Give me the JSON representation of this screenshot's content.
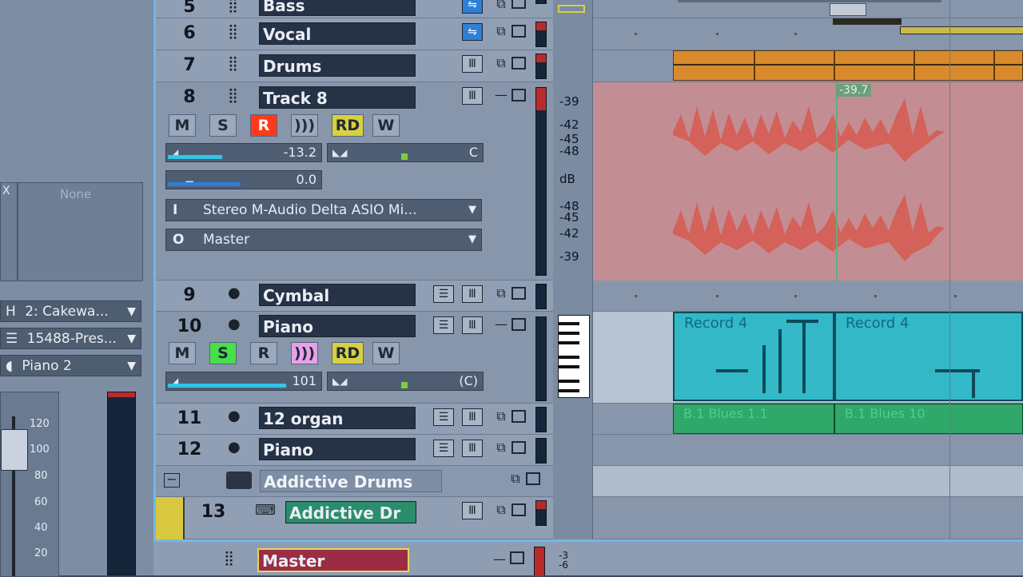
{
  "inspector": {
    "plugin_slot": "None",
    "x_label": "X",
    "dropdowns": [
      {
        "prefix": "H",
        "value": "2: Cakewa..."
      },
      {
        "prefix": "☰",
        "value": "15488-Pres..."
      },
      {
        "prefix": "◖",
        "value": "Piano 2"
      }
    ],
    "fader_scale": [
      "120",
      "100",
      "80",
      "60",
      "40",
      "20"
    ]
  },
  "tracks": [
    {
      "num": "5",
      "name": "Bass"
    },
    {
      "num": "6",
      "name": "Vocal"
    },
    {
      "num": "7",
      "name": "Drums"
    },
    {
      "num": "8",
      "name": "Track 8",
      "buttons": [
        "M",
        "S",
        "R",
        "))) ",
        "RD",
        "W"
      ],
      "volume": "-13.2",
      "volume_level": 0.36,
      "pan": "C",
      "pan_level": 0.5,
      "trim": "0.0",
      "trim_level": 0.48,
      "input_prefix": "I",
      "input": "Stereo M-Audio Delta ASIO Mi...",
      "output_prefix": "O",
      "output": "Master"
    },
    {
      "num": "9",
      "name": "Cymbal"
    },
    {
      "num": "10",
      "name": "Piano",
      "buttons": [
        "M",
        "S",
        "R",
        ")))",
        "RD",
        "W"
      ],
      "volume": "101",
      "volume_level": 0.78,
      "pan": "(C)",
      "pan_level": 0.5
    },
    {
      "num": "11",
      "name": "12 organ"
    },
    {
      "num": "12",
      "name": "Piano"
    },
    {
      "num": "",
      "name": "Addictive Drums"
    },
    {
      "num": "13",
      "name": "Addictive Dr"
    },
    {
      "num": "",
      "name": "Master"
    }
  ],
  "ruler": {
    "db_labels_top": [
      "-39",
      "-42",
      "-45",
      "-48"
    ],
    "db_unit": "dB",
    "db_labels_bottom": [
      "-48",
      "-45",
      "-42",
      "-39"
    ],
    "master_db": [
      "-3",
      "-6"
    ]
  },
  "clips": {
    "marker_value": "-39.7",
    "piano_clip_1": "Record 4",
    "piano_clip_2": "Record 4",
    "organ_clip_1": "B.1 Blues 1.1",
    "organ_clip_2": "B.1 Blues 10"
  },
  "colors": {
    "accent": "#6fb9e6",
    "record_red": "#ff3a1a",
    "solo_green": "#45e04a",
    "echo_pink": "#e8a0e8",
    "read_yellow": "#d8d040",
    "audio_clip": "#c77a7e",
    "midi_clip": "#33b8c8",
    "drum_clip": "#d98a2c",
    "organ_clip": "#2fa86a"
  }
}
